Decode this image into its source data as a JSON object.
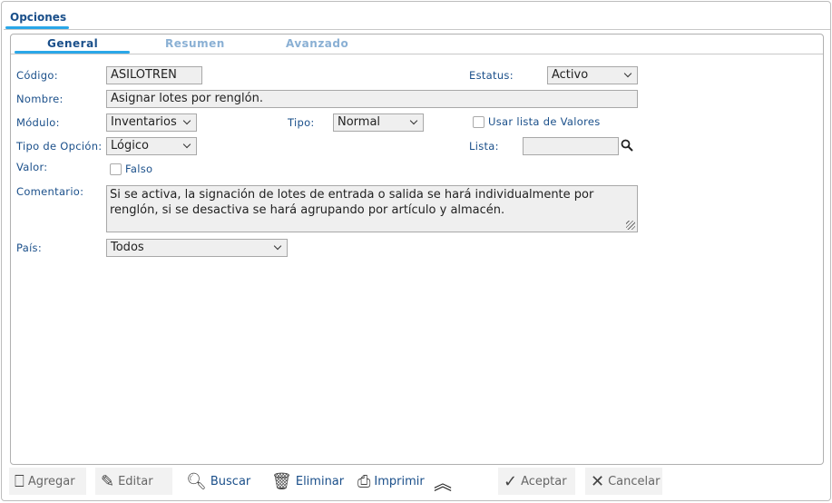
{
  "outer_tab": "Opciones",
  "tabs": [
    "General",
    "Resumen",
    "Avanzado"
  ],
  "form": {
    "codigo_label": "Código:",
    "codigo": "ASILOTREN",
    "estatus_label": "Estatus:",
    "estatus": "Activo",
    "nombre_label": "Nombre:",
    "nombre": "Asignar lotes por renglón.",
    "modulo_label": "Módulo:",
    "modulo": "Inventarios",
    "tipo_label": "Tipo:",
    "tipo": "Normal",
    "usar_lista_label": "Usar lista de Valores",
    "tipo_opcion_label": "Tipo de Opción:",
    "tipo_opcion": "Lógico",
    "lista_label": "Lista:",
    "lista": "",
    "valor_label": "Valor:",
    "valor_check_label": "Falso",
    "comentario_label": "Comentario:",
    "comentario": "Si se activa, la signación de lotes de entrada o salida se hará individualmente por renglón, si se desactiva se hará agrupando por artículo y almacén.",
    "pais_label": "País:",
    "pais": "Todos"
  },
  "toolbar": {
    "agregar": "Agregar",
    "editar": "Editar",
    "buscar": "Buscar",
    "eliminar": "Eliminar",
    "imprimir": "Imprimir",
    "aceptar": "Aceptar",
    "cancelar": "Cancelar"
  }
}
